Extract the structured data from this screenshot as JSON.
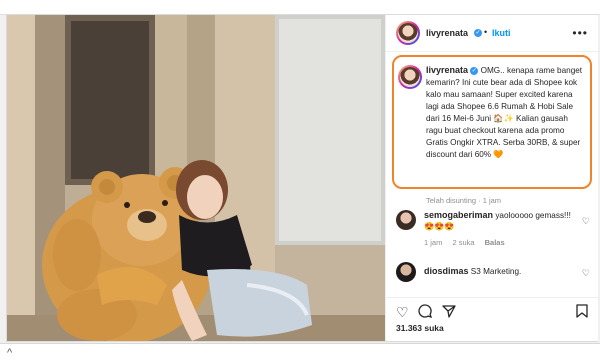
{
  "post": {
    "username": "livyrenata",
    "follow_label": "Ikuti",
    "more_label": "•••",
    "caption_username": "livyrenata",
    "caption_text": "OMG.. kenapa rame banget kemarin? Ini cute bear ada di Shopee kok kalo mau samaan! Super excited karena lagi ada Shopee 6.6 Rumah & Hobi Sale dari 16 Mei-6 Juni 🏠✨ Kalian gausah ragu buat checkout karena ada promo Gratis Ongkir XTRA. Serba 30RB, & super discount dari 60% 🧡",
    "edited_label": "Telah disunting · 1 jam",
    "likes": "31.363 suka"
  },
  "comments": [
    {
      "username": "semogaberiman",
      "text": "yaolooooo gemass!!! 😍😍😍",
      "time": "1 jam",
      "likes": "2 suka",
      "reply": "Balas"
    },
    {
      "username": "diosdimas",
      "text": "S3 Marketing."
    }
  ],
  "icons": {
    "like": "heart-icon",
    "comment": "comment-icon",
    "share": "send-icon",
    "save": "bookmark-icon"
  },
  "colors": {
    "link": "#0095f6",
    "highlight": "#f0842a",
    "verified": "#3897f0"
  }
}
